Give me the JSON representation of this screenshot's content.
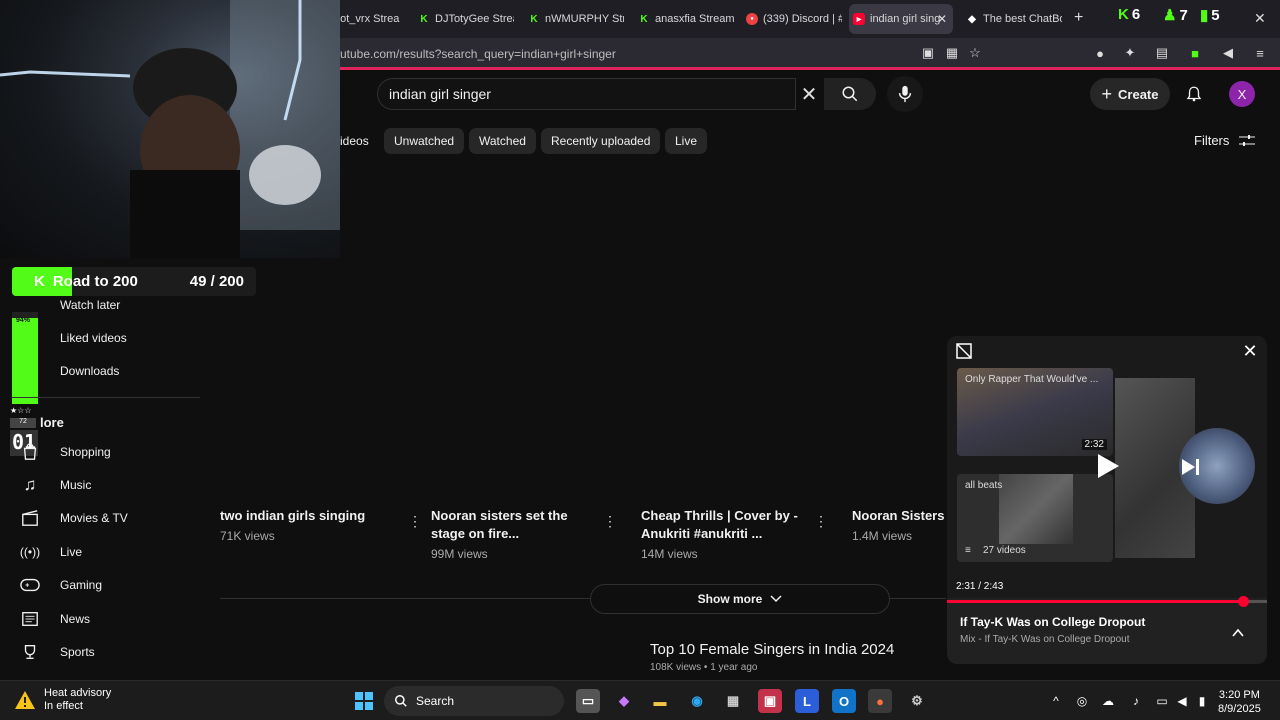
{
  "browser": {
    "tabs": [
      {
        "label": "not_vrx Strea",
        "icon": "kick-icon"
      },
      {
        "label": "DJTotyGee Strea",
        "icon": "kick-icon"
      },
      {
        "label": "nWMURPHY Stre",
        "icon": "kick-icon"
      },
      {
        "label": "anasxfia Stream",
        "icon": "kick-icon"
      },
      {
        "label": "(339) Discord | #",
        "icon": "discord-icon"
      },
      {
        "label": "indian girl sing",
        "icon": "youtube-icon",
        "active": true
      },
      {
        "label": "The best ChatBo",
        "icon": "chatbot-icon"
      }
    ],
    "new_tab": "+",
    "counters": [
      {
        "icon": "kick-icon",
        "value": "6"
      },
      {
        "icon": "user-icon",
        "value": "7"
      },
      {
        "icon": "bars-icon",
        "value": "5"
      }
    ],
    "url": "utube.com/results?search_query=indian+girl+singer"
  },
  "youtube": {
    "search": {
      "value": "indian girl singer"
    },
    "create_label": "Create",
    "avatar_letter": "X",
    "chips": [
      "ideos",
      "Unwatched",
      "Watched",
      "Recently uploaded",
      "Live"
    ],
    "filters_label": "Filters",
    "sidebar_top": [
      {
        "label": "Watch later",
        "icon": "clock-icon"
      },
      {
        "label": "Liked videos",
        "icon": "thumbs-up-icon"
      },
      {
        "label": "Downloads",
        "icon": "download-icon"
      }
    ],
    "more_label": "lore",
    "sidebar_explore": [
      {
        "label": "Shopping",
        "icon": "shopping-bag-icon"
      },
      {
        "label": "Music",
        "icon": "music-note-icon"
      },
      {
        "label": "Movies & TV",
        "icon": "clapperboard-icon"
      },
      {
        "label": "Live",
        "icon": "live-icon"
      },
      {
        "label": "Gaming",
        "icon": "gamepad-icon"
      },
      {
        "label": "News",
        "icon": "news-icon"
      },
      {
        "label": "Sports",
        "icon": "trophy-icon"
      }
    ],
    "results": [
      {
        "title": "two indian girls singing",
        "views": "71K views"
      },
      {
        "title": "Nooran sisters set the stage on fire...",
        "views": "99M views"
      },
      {
        "title": "Cheap Thrills | Cover by - Anukriti #anukriti ...",
        "views": "14M views"
      },
      {
        "title": "Nooran Sisters !",
        "views": "1.4M views"
      }
    ],
    "show_more": "Show more",
    "next_title": "Top 10 Female Singers in India 2024",
    "next_meta": "108K views • 1 year ago",
    "miniplayer": {
      "upnext1": {
        "title": "Only Rapper That Would've ...",
        "duration": "2:32"
      },
      "upnext2": {
        "title": "all beats",
        "count": "27 videos"
      },
      "time": "2:31 / 2:43",
      "progress": 0.926,
      "title": "If Tay-K Was on College Dropout",
      "subtitle": "Mix - If Tay-K Was on College Dropout"
    }
  },
  "overlay": {
    "goal_label": "Road to 200",
    "goal_count": "49 / 200",
    "goal_progress": 0.245,
    "volume_pct": "94%",
    "volume_level": 0.94,
    "stars": "★☆☆",
    "rank_small": "72",
    "rank_big": "01"
  },
  "taskbar": {
    "weather_title": "Heat advisory",
    "weather_sub": "In effect",
    "search_label": "Search",
    "time": "3:20 PM",
    "date": "8/9/2025"
  },
  "colors": {
    "kick": "#53fc18",
    "youtube_red": "#ff0033",
    "accent": "#e0245e"
  }
}
